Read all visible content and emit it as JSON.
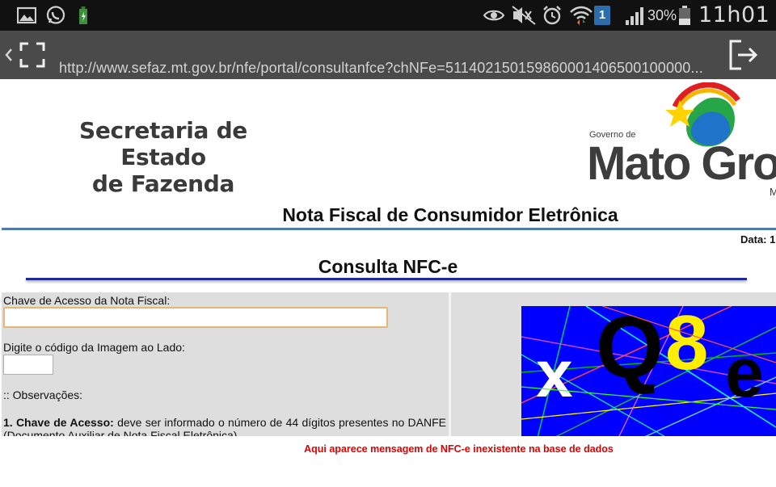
{
  "status_bar": {
    "battery_percent": "30%",
    "time": "11h01",
    "notification_badge": "1",
    "icons": [
      "gallery-icon",
      "whatsapp-icon",
      "battery-charging-icon",
      "eye-icon",
      "mute-icon",
      "alarm-icon",
      "wifi-icon",
      "signal-icon",
      "battery-icon"
    ]
  },
  "browser": {
    "url": "http://www.sefaz.mt.gov.br/nfe/portal/consultanfce?chNFe=511402150159860001406500100000...",
    "icons": [
      "back-chevron-icon",
      "fullscreen-icon",
      "exit-icon"
    ]
  },
  "header": {
    "sefaz_line1": "Secretaria de Estado",
    "sefaz_line2": "de Fazenda",
    "mt_gov": "Governo de",
    "mt_name": "Mato Gro",
    "mt_sub": "M",
    "page_title": "Nota Fiscal de Consumidor Eletrônica",
    "date_label": "Data: 1"
  },
  "consulta": {
    "title": "Consulta NFC-e",
    "access_key_label": "Chave de Acesso da Nota Fiscal:",
    "access_key_value": "",
    "captcha_label": "Digite o código da Imagem ao Lado:",
    "captcha_value": "",
    "observations_label": ":: Observações:",
    "obs_1_bold": "1. Chave de Acesso:",
    "obs_1_text": " deve ser informado o número de 44 dígitos presentes no DANFE (Documento Auxiliar de Nota Fiscal Eletrônica)",
    "captcha_text": "xQ8e"
  },
  "message": {
    "error": "Aqui aparece mensagem de NFC-e inexistente na base de dados"
  },
  "colors": {
    "status_bar": "#111111",
    "url_bar": "#4a4a4a",
    "title_rule": "#4d7aa8",
    "consulta_rule": "#1c2a9a",
    "panel": "#dedede",
    "error": "#e00000",
    "captcha_bg": "#0000ff"
  }
}
